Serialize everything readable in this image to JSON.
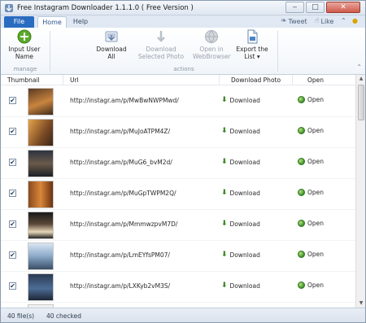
{
  "window": {
    "title": "Free Instagram Downloader 1.1.1.0 ( Free Version )",
    "controls": [
      "‒",
      "□",
      "✕"
    ]
  },
  "ribbon": {
    "tabs": [
      {
        "label": "File"
      },
      {
        "label": "Home"
      },
      {
        "label": "Help"
      }
    ],
    "social": {
      "tweet": "Tweet",
      "like": "Like"
    },
    "groups": {
      "manage": "manage",
      "actions": "actions"
    },
    "buttons": {
      "input_user_name": "Input User Name",
      "download_all": "Download All",
      "download_selected": "Download Selected Photo",
      "open_in_browser": "Open in WebBrowser",
      "export_list": "Export the List"
    }
  },
  "table": {
    "columns": {
      "thumbnail": "Thumbnail",
      "url": "Url",
      "download_photo": "Download Photo",
      "open": "Open"
    },
    "rows": [
      {
        "checked": "✔",
        "url": "http://instagr.am/p/MwBwNWPMwd/",
        "download": "Download",
        "open": "Open"
      },
      {
        "checked": "✔",
        "url": "http://instagr.am/p/MuJoATPM4Z/",
        "download": "Download",
        "open": "Open"
      },
      {
        "checked": "✔",
        "url": "http://instagr.am/p/MuG6_bvM2d/",
        "download": "Download",
        "open": "Open"
      },
      {
        "checked": "✔",
        "url": "http://instagr.am/p/MuGpTWPM2Q/",
        "download": "Download",
        "open": "Open"
      },
      {
        "checked": "✔",
        "url": "http://instagr.am/p/MmmwzpvM7D/",
        "download": "Download",
        "open": "Open"
      },
      {
        "checked": "✔",
        "url": "http://instagr.am/p/LmEYfsPM07/",
        "download": "Download",
        "open": "Open"
      },
      {
        "checked": "✔",
        "url": "http://instagr.am/p/LXKyb2vM3S/",
        "download": "Download",
        "open": "Open"
      }
    ]
  },
  "status": {
    "files": "40 file(s)",
    "checked": "40 checked"
  },
  "colors": {
    "file_tab": "#2a6cc0",
    "download_arrow": "#3d8a27",
    "add_button": "#5aaa2a"
  },
  "icons": {
    "add": "plus-circle-icon",
    "download": "down-arrow-icon",
    "open": "globe-icon",
    "export": "document-icon"
  }
}
